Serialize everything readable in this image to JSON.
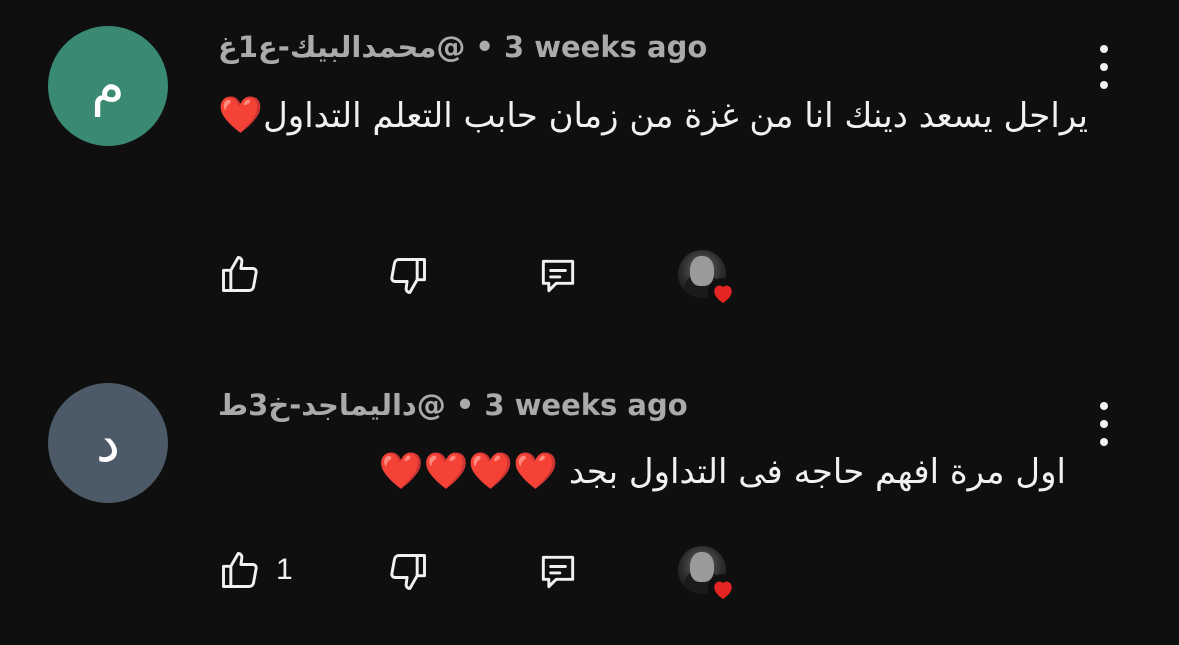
{
  "comments": [
    {
      "author": "@محمدالبيك-ع1غ",
      "separator": "•",
      "time": "3 weeks ago",
      "avatar_letter": "م",
      "avatar_color": "#3a8a73",
      "text": "يراجل يسعد دينك انا من غزة من زمان حابب التعلم التداول",
      "hearts": "❤️",
      "like_count": ""
    },
    {
      "author": "@داليماجد-خ3ط",
      "separator": "•",
      "time": "3 weeks ago",
      "avatar_letter": "د",
      "avatar_color": "#4b5a66",
      "text": "اول مرة افهم حاجه فى التداول بجد",
      "hearts": "❤️❤️❤️❤️",
      "like_count": "1"
    }
  ],
  "icons": {
    "like": "thumbs-up-icon",
    "dislike": "thumbs-down-icon",
    "reply": "comment-icon",
    "menu": "more-vertical-icon",
    "creator_heart": "creator-heart-icon"
  },
  "colors": {
    "background": "#0f0f0f",
    "text": "#f1f1f1",
    "meta": "#aaaaaa",
    "heart": "#e52424"
  }
}
